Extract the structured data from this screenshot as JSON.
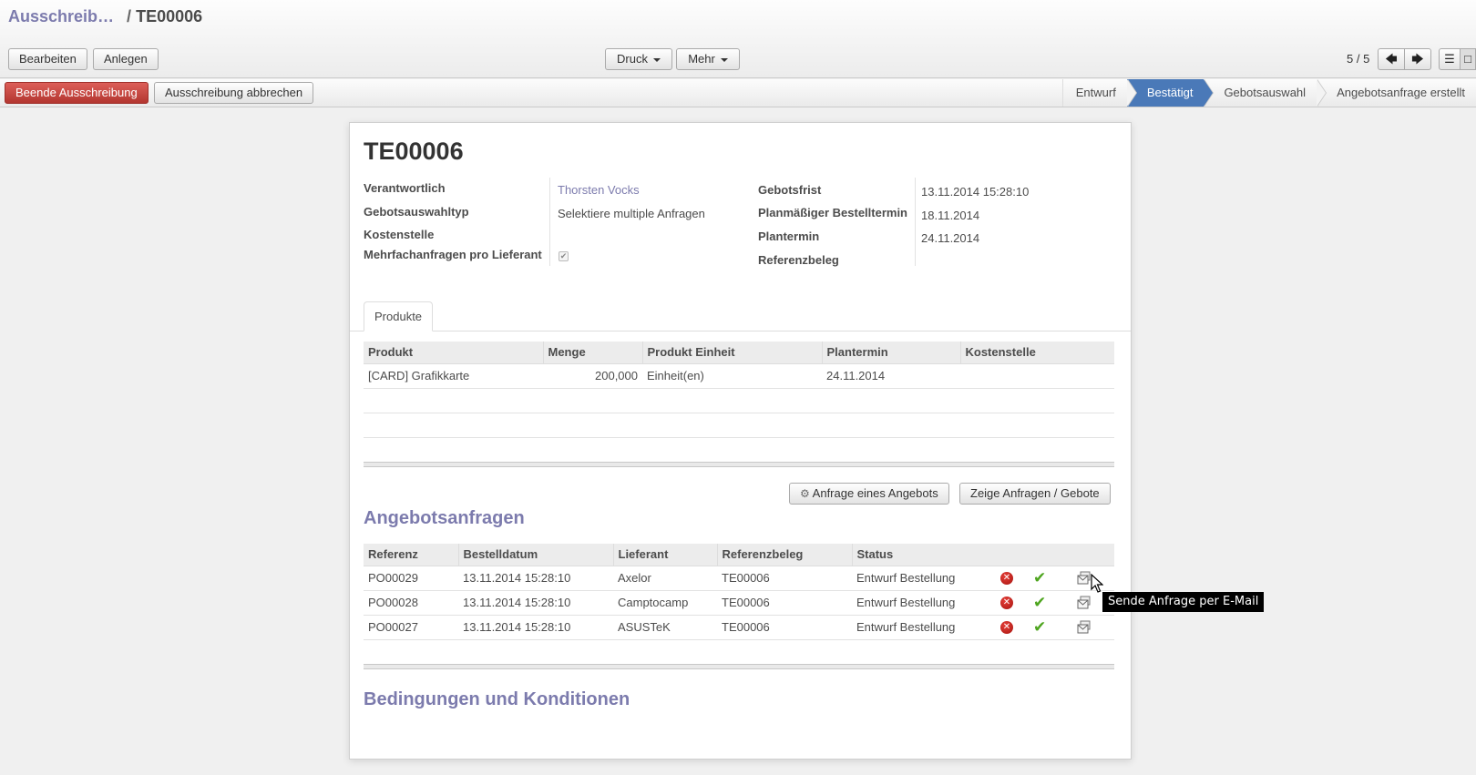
{
  "breadcrumb": {
    "parent": "Ausschreib…",
    "separator": "/",
    "current": "TE00006"
  },
  "toolbar": {
    "edit": "Bearbeiten",
    "create": "Anlegen",
    "print": "Druck",
    "more": "Mehr"
  },
  "pager": {
    "text": "5 / 5"
  },
  "actions": {
    "finish": "Beende Ausschreibung",
    "cancel": "Ausschreibung abbrechen"
  },
  "stages": [
    "Entwurf",
    "Bestätigt",
    "Gebotsauswahl",
    "Angebotsanfrage erstellt"
  ],
  "active_stage": "Bestätigt",
  "form": {
    "title": "TE00006",
    "left": [
      {
        "label": "Verantwortlich",
        "value": "Thorsten Vocks"
      },
      {
        "label": "Gebotsauswahltyp",
        "value": "Selektiere multiple Anfragen"
      },
      {
        "label": "Kostenstelle",
        "value": ""
      },
      {
        "label": "Mehrfachanfragen pro Lieferant",
        "value": "✔"
      }
    ],
    "right": [
      {
        "label": "Gebotsfrist",
        "value": "13.11.2014 15:28:10"
      },
      {
        "label": "Planmäßiger Bestelltermin",
        "value": "18.11.2014"
      },
      {
        "label": "Plantermin",
        "value": "24.11.2014"
      },
      {
        "label": "Referenzbeleg",
        "value": ""
      }
    ]
  },
  "tabs": {
    "products": "Produkte"
  },
  "products": {
    "headers": [
      "Produkt",
      "Menge",
      "Produkt Einheit",
      "Plantermin",
      "Kostenstelle"
    ],
    "rows": [
      [
        "[CARD] Grafikkarte",
        "200,000",
        "Einheit(en)",
        "24.11.2014",
        ""
      ]
    ]
  },
  "rfq_buttons": {
    "request": "Anfrage eines Angebots",
    "show": "Zeige Anfragen / Gebote"
  },
  "rfq": {
    "title": "Angebotsanfragen",
    "headers": [
      "Referenz",
      "Bestelldatum",
      "Lieferant",
      "Referenzbeleg",
      "Status"
    ],
    "rows": [
      [
        "PO00029",
        "13.11.2014 15:28:10",
        "Axelor",
        "TE00006",
        "Entwurf Bestellung"
      ],
      [
        "PO00028",
        "13.11.2014 15:28:10",
        "Camptocamp",
        "TE00006",
        "Entwurf Bestellung"
      ],
      [
        "PO00027",
        "13.11.2014 15:28:10",
        "ASUSTeK",
        "TE00006",
        "Entwurf Bestellung"
      ]
    ]
  },
  "terms": {
    "title": "Bedingungen und Konditionen"
  },
  "tooltip": "Sende Anfrage per E-Mail",
  "colors": {
    "accent": "#7c7bad",
    "active_stage": "#4a79b8",
    "primary_action": "#c9302c"
  }
}
